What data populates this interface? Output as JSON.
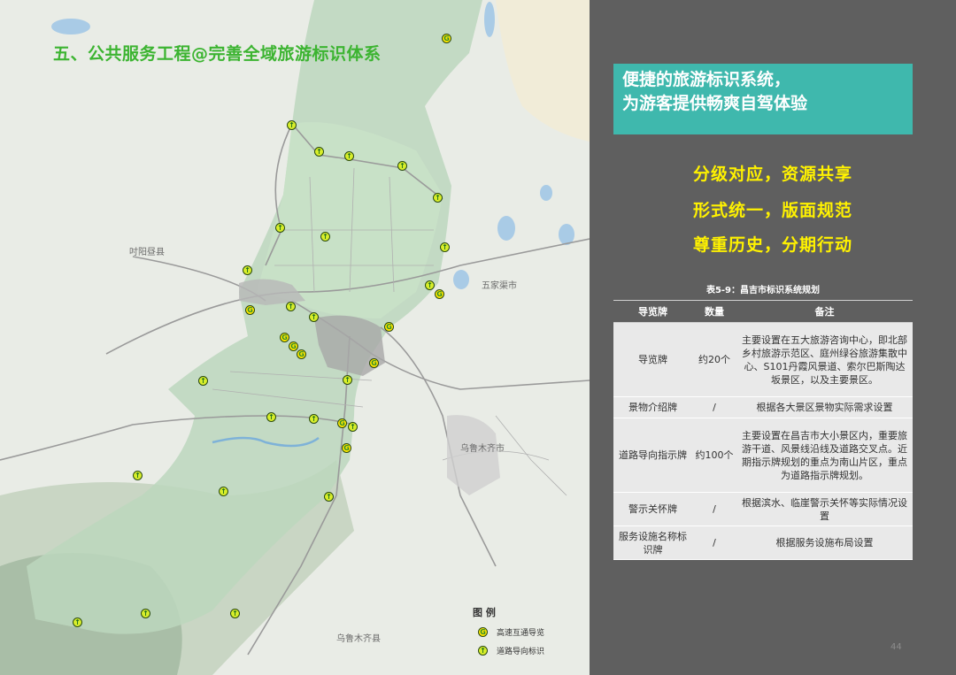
{
  "map": {
    "title": "五、公共服务工程@完善全域旅游标识体系",
    "places": {
      "qitai": "吋阳昼县",
      "wujiaqu": "五家渠市",
      "urumqi": "乌鲁木齐市",
      "urumqi_county": "乌鲁木齐县"
    },
    "legend": {
      "title": "图 例",
      "items": [
        {
          "label": "高速互通导览",
          "icon": "highway-interchange-guide-icon",
          "glyph": "G"
        },
        {
          "label": "道路导向标识",
          "icon": "road-direction-sign-icon",
          "glyph": "↑"
        }
      ]
    }
  },
  "slogan_box": {
    "line1": "便捷的旅游标识系统，",
    "line2": "为游客提供畅爽自驾体验"
  },
  "slogans": [
    "分级对应，资源共享",
    "形式统一，版面规范",
    "尊重历史，分期行动"
  ],
  "table": {
    "caption": "表5-9：昌吉市标识系统规划",
    "headers": [
      "导览牌",
      "数量",
      "备注"
    ],
    "rows": [
      {
        "name": "导览牌",
        "quantity": "约20个",
        "note": "主要设置在五大旅游咨询中心，即北部乡村旅游示范区、庭州绿谷旅游集散中心、S101丹霞风景道、索尔巴斯陶达坂景区，以及主要景区。"
      },
      {
        "name": "景物介绍牌",
        "quantity": "/",
        "note": "根据各大景区景物实际需求设置"
      },
      {
        "name": "道路导向指示牌",
        "quantity": "约100个",
        "note": "主要设置在昌吉市大小景区内，重要旅游干道、风景线沿线及道路交叉点。近期指示牌规划的重点为南山片区，重点为道路指示牌规划。"
      },
      {
        "name": "警示关怀牌",
        "quantity": "/",
        "note": "根据滨水、临崖警示关怀等实际情况设置"
      },
      {
        "name": "服务设施名称标识牌",
        "quantity": "/",
        "note": "根据服务设施布局设置"
      }
    ]
  },
  "page_number": "44",
  "colors": {
    "title_green": "#3cb431",
    "teal_box": "#3fb8ad",
    "slogan_yellow": "#fff200",
    "panel_gray": "#5f5f5f"
  }
}
